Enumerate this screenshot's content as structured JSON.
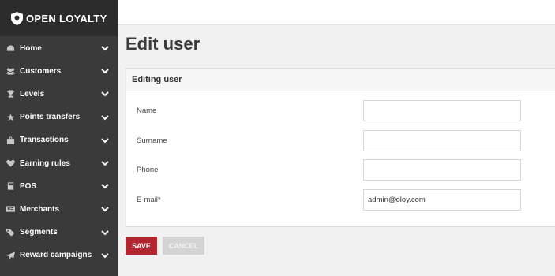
{
  "app": {
    "name": "OPEN LOYALTY"
  },
  "sidebar": {
    "items": [
      {
        "label": "Home",
        "icon": "dashboard-icon"
      },
      {
        "label": "Customers",
        "icon": "users-icon"
      },
      {
        "label": "Levels",
        "icon": "trophy-icon"
      },
      {
        "label": "Points transfers",
        "icon": "star-icon"
      },
      {
        "label": "Transactions",
        "icon": "shopping-bag-icon"
      },
      {
        "label": "Earning rules",
        "icon": "heart-icon"
      },
      {
        "label": "POS",
        "icon": "pos-icon"
      },
      {
        "label": "Merchants",
        "icon": "id-card-icon"
      },
      {
        "label": "Segments",
        "icon": "tags-icon"
      },
      {
        "label": "Reward campaigns",
        "icon": "paper-plane-icon"
      }
    ]
  },
  "page": {
    "title": "Edit user"
  },
  "form": {
    "header": "Editing user",
    "fields": [
      {
        "label": "Name",
        "value": ""
      },
      {
        "label": "Surname",
        "value": ""
      },
      {
        "label": "Phone",
        "value": ""
      },
      {
        "label": "E-mail*",
        "value": "admin@oloy.com"
      }
    ]
  },
  "actions": {
    "save_label": "SAVE",
    "cancel_label": "CANCEL"
  },
  "colors": {
    "sidebar_bg": "#3a3a3a",
    "logo_bg": "#2c2c2c",
    "save_button": "#b3262f",
    "cancel_button": "#d4d4d4"
  }
}
